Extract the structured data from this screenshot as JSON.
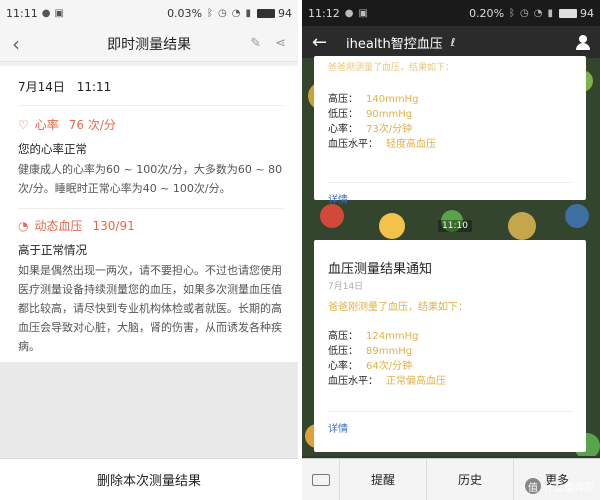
{
  "left": {
    "status": {
      "time": "11:11",
      "speed": "0.03",
      "speed_unit": "%",
      "battery": "94"
    },
    "header": {
      "back_icon": "back-arrow-icon",
      "title": "即时测量结果",
      "edit_icon": "edit-icon",
      "share_icon": "share-icon"
    },
    "date": "7月14日",
    "time": "11:11",
    "heart": {
      "label": "心率",
      "value": "76 次/分",
      "status": "您的心率正常",
      "desc": "健康成人的心率为60 ~ 100次/分，大多数为60 ~ 80次/分。睡眠时正常心率为40 ~ 100次/分。"
    },
    "bp": {
      "label": "动态血压",
      "value": "130/91",
      "status": "高于正常情况",
      "desc": "如果是偶然出现一两次，请不要担心。不过也请您使用医疗测量设备持续测量您的血压，如果多次测量血压值都比较高，请尽快到专业机构体检或者就医。长期的高血压会导致对心脏，大脑，肾的伤害，从而诱发各种疾病。"
    },
    "delete_button": "删除本次测量结果",
    "accent": "#e8684a"
  },
  "right": {
    "status": {
      "time": "11:12",
      "speed": "0.20",
      "speed_unit": "%",
      "battery": "94"
    },
    "header": {
      "title": "ihealth智控血压",
      "user_icon": "user-icon"
    },
    "card1": {
      "faded_intro": "爸爸刚测量了血压，结果如下：",
      "high_label": "高压：",
      "high": "140mmHg",
      "low_label": "低压：",
      "low": "90mmHg",
      "hr_label": "心率：",
      "hr": "73次/分钟",
      "level_label": "血压水平：",
      "level": "轻度高血压",
      "details": "详情"
    },
    "timestamp": "11:10",
    "card2": {
      "title": "血压测量结果通知",
      "date": "7月14日",
      "intro": "爸爸刚测量了血压，结果如下：",
      "high_label": "高压：",
      "high": "124mmHg",
      "low_label": "低压：",
      "low": "89mmHg",
      "hr_label": "心率：",
      "hr": "64次/分钟",
      "level_label": "血压水平：",
      "level": "正常偏高血压",
      "details": "详情"
    },
    "footer": {
      "btn1": "提醒",
      "btn2": "历史",
      "btn3": "更多"
    },
    "watermark": "什么值得买",
    "accent": "#e0b045",
    "link_color": "#3a6fbf"
  }
}
